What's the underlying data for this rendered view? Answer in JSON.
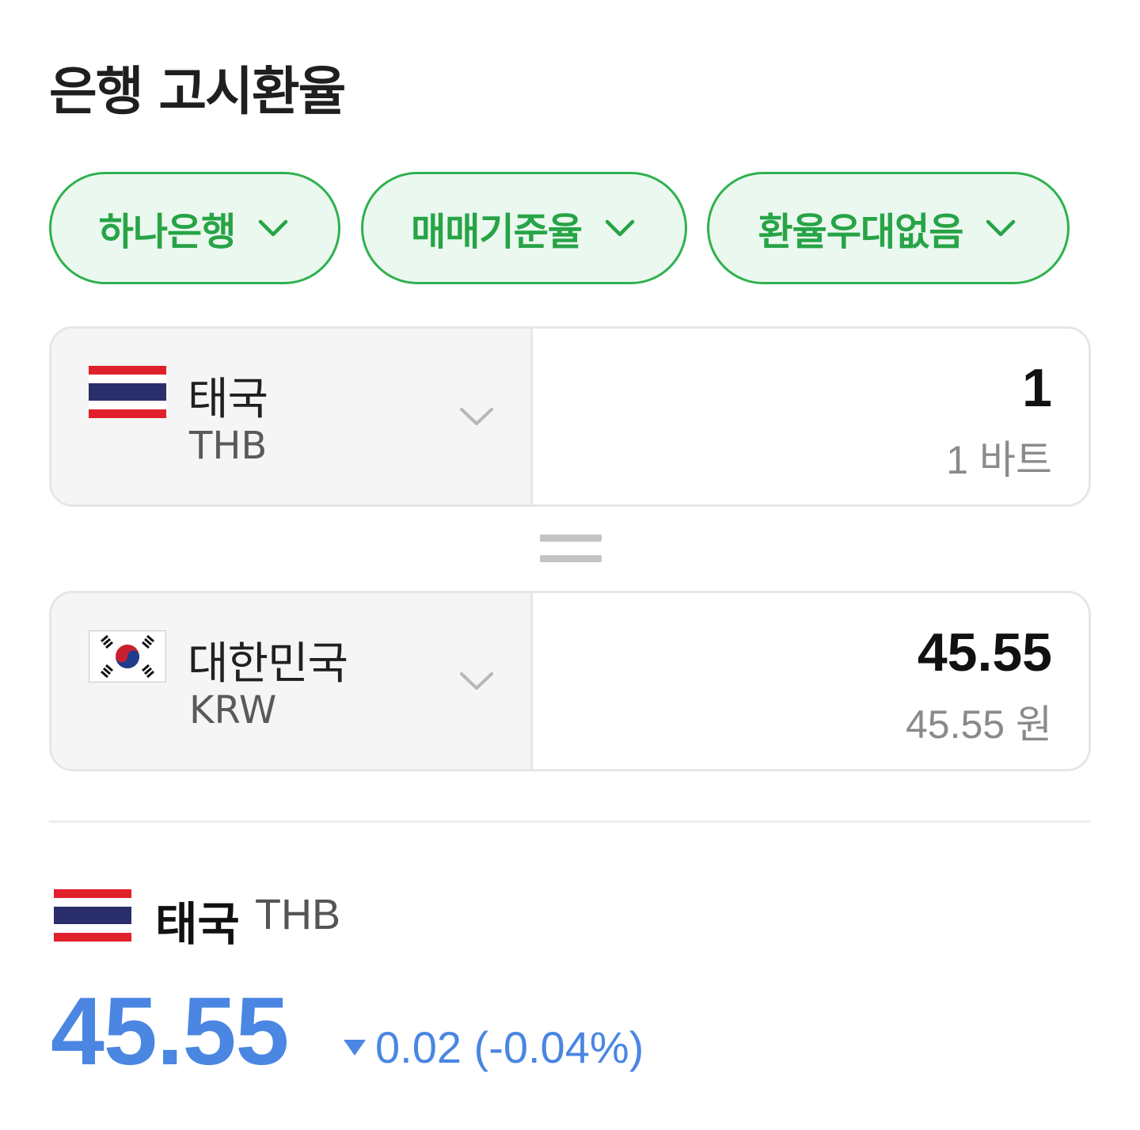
{
  "title": "은행 고시환율",
  "filters": [
    {
      "label": "하나은행",
      "icon": "chevron-down-icon"
    },
    {
      "label": "매매기준율",
      "icon": "chevron-down-icon"
    },
    {
      "label": "환율우대없음",
      "icon": "chevron-down-icon"
    }
  ],
  "colors": {
    "accent_green": "#2fb14e",
    "pill_bg": "#ebf8ef",
    "rate_blue": "#4a86e2"
  },
  "converter": {
    "from": {
      "country": "태국",
      "code": "THB",
      "flag": "thailand-flag-icon",
      "amount": "1",
      "amount_text": "1 바트"
    },
    "to": {
      "country": "대한민국",
      "code": "KRW",
      "flag": "south-korea-flag-icon",
      "amount": "45.55",
      "amount_text": "45.55 원"
    }
  },
  "summary": {
    "country": "태국",
    "code": "THB",
    "rate": "45.55",
    "change": "0.02 (-0.04%)",
    "direction": "down"
  }
}
